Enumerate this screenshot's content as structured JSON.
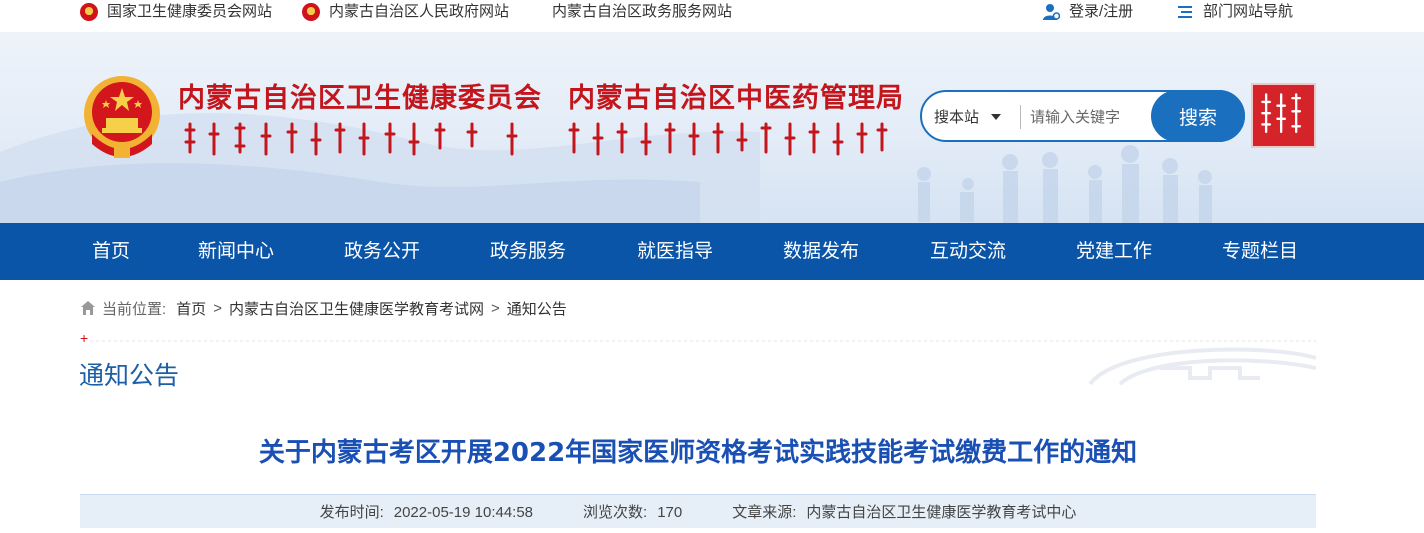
{
  "topbar": {
    "links": [
      {
        "label": "国家卫生健康委员会网站"
      },
      {
        "label": "内蒙古自治区人民政府网站"
      },
      {
        "label": "内蒙古自治区政务服务网站"
      }
    ],
    "login_label": "登录/注册",
    "dept_nav_label": "部门网站导航"
  },
  "header": {
    "title_left": "内蒙古自治区卫生健康委员会",
    "title_right": "内蒙古自治区中医药管理局",
    "search": {
      "scope": "搜本站",
      "placeholder": "请输入关键字",
      "button": "搜索"
    }
  },
  "nav": {
    "items": [
      "首页",
      "新闻中心",
      "政务公开",
      "政务服务",
      "就医指导",
      "数据发布",
      "互动交流",
      "党建工作",
      "专题栏目"
    ]
  },
  "breadcrumb": {
    "label": "当前位置:",
    "items": [
      "首页",
      "内蒙古自治区卫生健康医学教育考试网",
      "通知公告"
    ],
    "separator": ">"
  },
  "section": {
    "title": "通知公告"
  },
  "article": {
    "title": "关于内蒙古考区开展2022年国家医师资格考试实践技能考试缴费工作的通知",
    "meta": {
      "publish_label": "发布时间:",
      "publish_value": "2022-05-19 10:44:58",
      "views_label": "浏览次数:",
      "views_value": "170",
      "source_label": "文章来源:",
      "source_value": "内蒙古自治区卫生健康医学教育考试中心"
    }
  },
  "colors": {
    "nav_bg": "#0a55a8",
    "brand_red": "#c2161c",
    "search_blue": "#1a6fbf",
    "article_title": "#1a4fb3",
    "meta_bg": "#e6eff8"
  }
}
